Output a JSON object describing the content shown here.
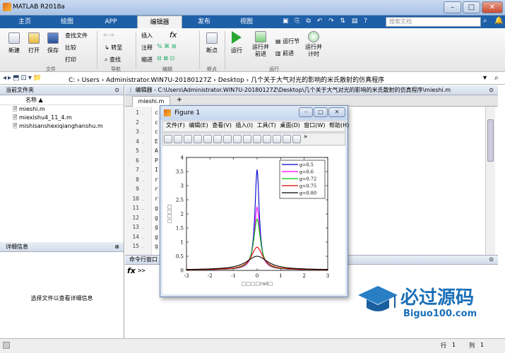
{
  "window": {
    "title": "MATLAB R2018a",
    "min": "–",
    "max": "□",
    "close": "✕"
  },
  "tabs": [
    {
      "label": "主页"
    },
    {
      "label": "绘图"
    },
    {
      "label": "APP"
    },
    {
      "label": "编辑器"
    },
    {
      "label": "发布"
    },
    {
      "label": "视图"
    }
  ],
  "search": {
    "placeholder": "搜索文档"
  },
  "ribbon": {
    "file": {
      "new": "新建",
      "open": "打开",
      "save": "保存",
      "find_files": "查找文件",
      "compare": "比较",
      "print": "打印",
      "group": "文件"
    },
    "navigate": {
      "goto": "转至",
      "find": "查找",
      "group": "导航"
    },
    "edit": {
      "insert": "插入",
      "comment": "注释",
      "indent": "缩进",
      "fx": "fx",
      "group": "编辑"
    },
    "breakpoints": {
      "label": "断点",
      "group": "断点"
    },
    "run": {
      "run": "运行",
      "run_advance": "运行并\n前进",
      "run_section": "运行节",
      "advance": "前进",
      "run_time": "运行并\n计时",
      "group": "运行"
    }
  },
  "address": {
    "path": "C: › Users › Administrator.WIN7U-20180127Z › Desktop › 几个关于大气对光的影响的米氏散射的仿真程序"
  },
  "current_folder": {
    "title": "当前文件夹",
    "column": "名称 ▲",
    "files": [
      "mieshi.m",
      "miexishu4_11_4.m",
      "mishisanshexiqianghanshu.m"
    ]
  },
  "details": {
    "title": "详细信息",
    "message": "选择文件以查看详细信息"
  },
  "editor": {
    "title": "编辑器 - C:\\Users\\Administrator.WIN7U-20180127Z\\Desktop\\几个关于大气对光的影响的米氏散射的仿真程序\\mieshi.m",
    "tab": "mieshi.m",
    "add": "+",
    "lines": [
      {
        "n": "1",
        "c": "c"
      },
      {
        "n": "2",
        "c": "c"
      },
      {
        "n": "3",
        "c": "c"
      },
      {
        "n": "4",
        "c": "E"
      },
      {
        "n": "5",
        "c": "A"
      },
      {
        "n": "6",
        "c": "P"
      },
      {
        "n": "7",
        "c": "I"
      },
      {
        "n": "8",
        "c": "r"
      },
      {
        "n": "9",
        "c": "r"
      },
      {
        "n": "10",
        "c": "r"
      },
      {
        "n": "11",
        "c": "g"
      },
      {
        "n": "12",
        "c": "g"
      },
      {
        "n": "13",
        "c": "g"
      },
      {
        "n": "14",
        "c": "g"
      },
      {
        "n": "15",
        "c": "g"
      }
    ]
  },
  "command_window": {
    "title": "命令行窗口",
    "fx": "fx",
    "prompt": ">>"
  },
  "status": {
    "row_label": "行",
    "row": "1",
    "col_label": "列",
    "col": "1"
  },
  "figure": {
    "title": "Figure 1",
    "menu": [
      "文件(F)",
      "编辑(E)",
      "查看(V)",
      "插入(I)",
      "工具(T)",
      "桌面(D)",
      "窗口(W)",
      "帮助(H)"
    ],
    "more": "»"
  },
  "chart_data": {
    "type": "line",
    "xlim": [
      -3,
      3
    ],
    "ylim": [
      0,
      4
    ],
    "xticks": [
      "-3",
      "-2",
      "-1",
      "0",
      "1",
      "2",
      "3"
    ],
    "yticks": [
      "0",
      "0.5",
      "1",
      "1.5",
      "2",
      "2.5",
      "3",
      "3.5",
      "4"
    ],
    "xlabel": "□□□□rad□",
    "ylabel": "□□□□",
    "legend_position": "top-right",
    "series": [
      {
        "name": "g=0.5",
        "color": "#0000cc",
        "peak": 3.55,
        "width": 0.11
      },
      {
        "name": "g=0.6",
        "color": "#ff00ff",
        "peak": 2.22,
        "width": 0.14
      },
      {
        "name": "g=0.72",
        "color": "#00cc00",
        "peak": 1.8,
        "width": 0.17
      },
      {
        "name": "g=0.75",
        "color": "#dd0000",
        "peak": 0.8,
        "width": 0.3
      },
      {
        "name": "g=0.80",
        "color": "#000000",
        "peak": 0.48,
        "width": 0.55
      }
    ]
  },
  "watermark": {
    "brand": "必过源码",
    "url": "Biguo100.com"
  }
}
